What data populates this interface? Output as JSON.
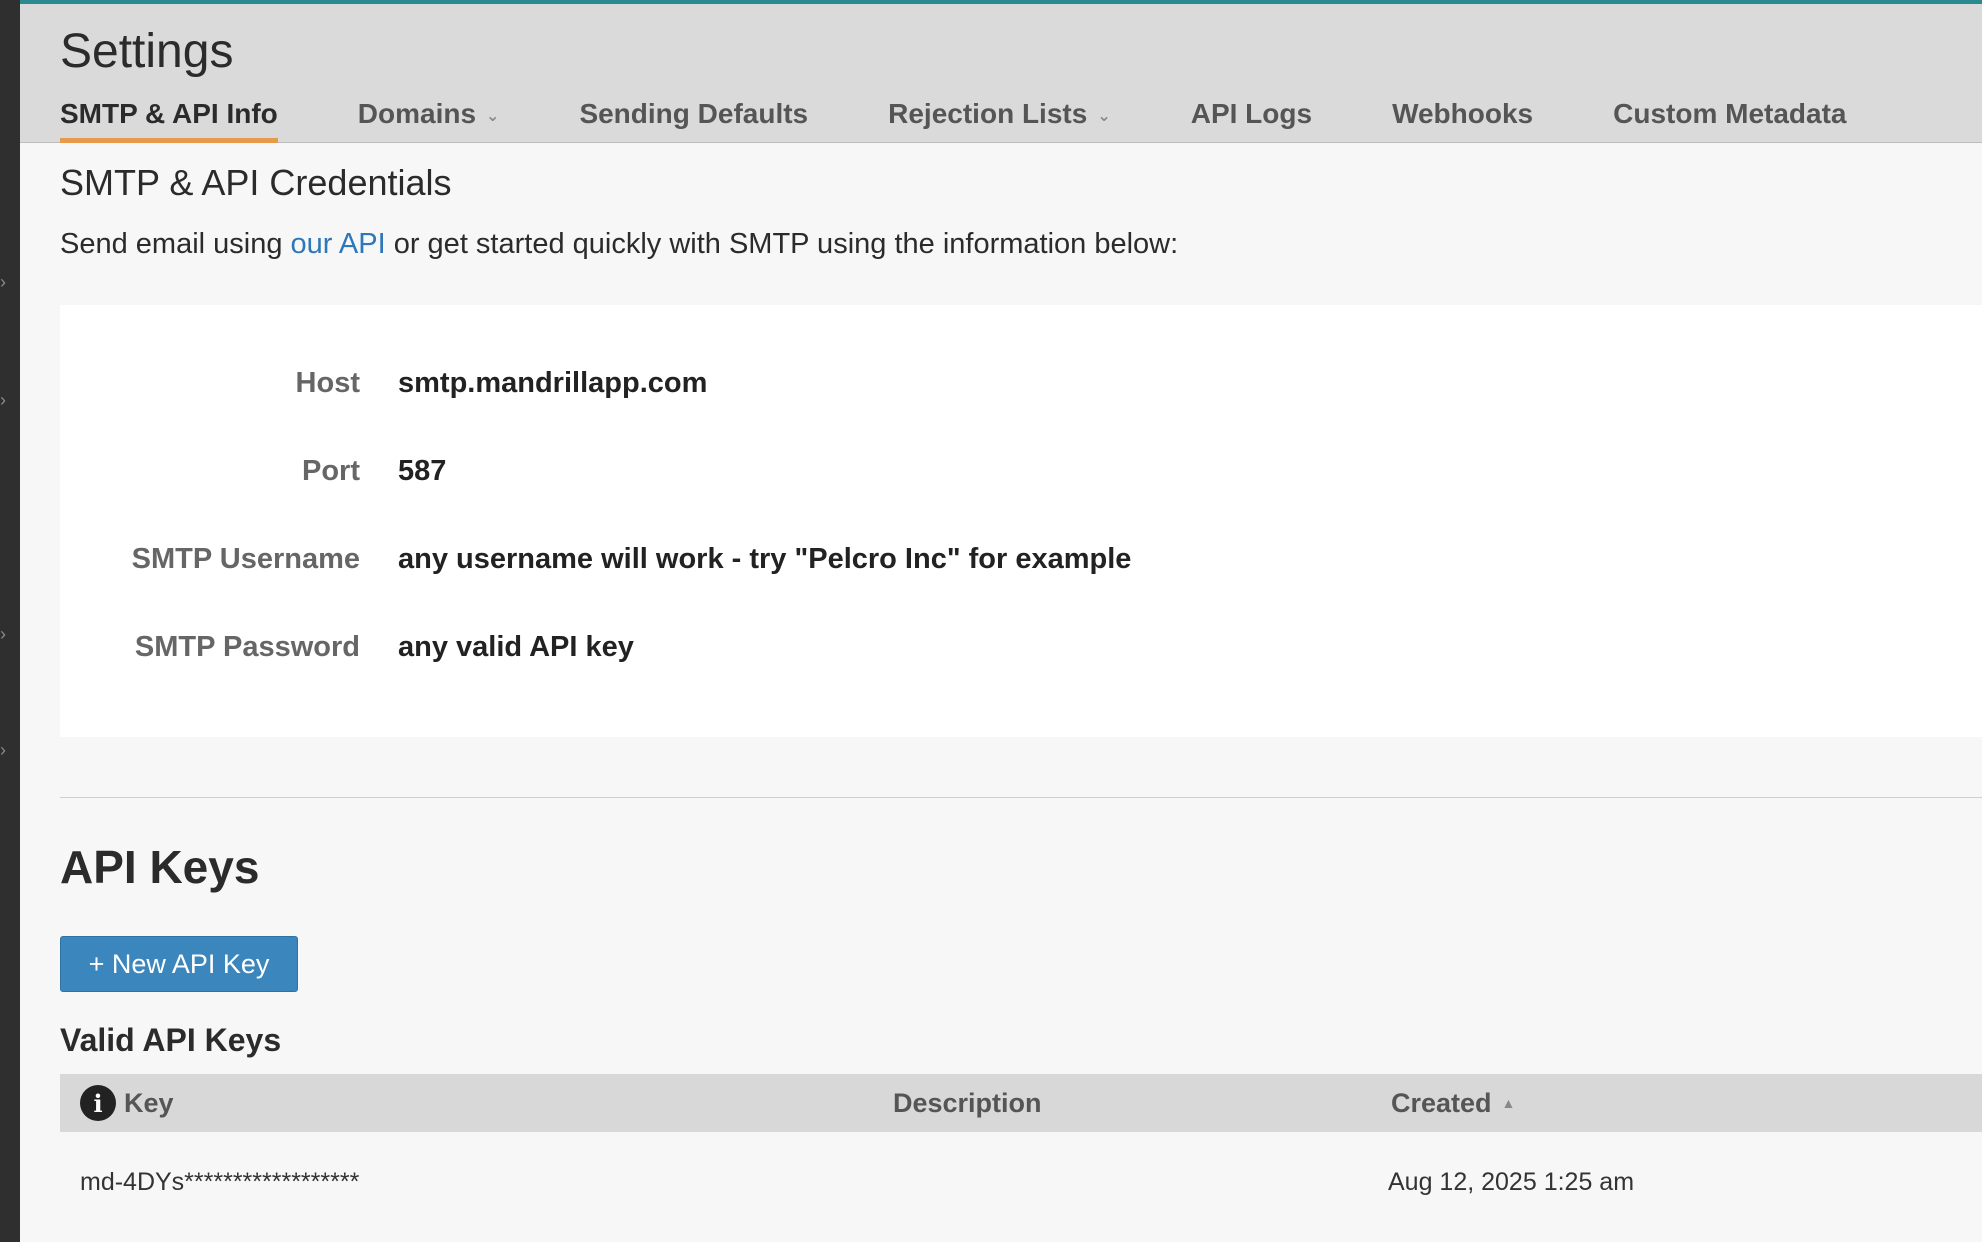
{
  "header": {
    "title": "Settings",
    "tabs": [
      {
        "label": "SMTP & API Info",
        "active": true,
        "has_dropdown": false
      },
      {
        "label": "Domains",
        "active": false,
        "has_dropdown": true
      },
      {
        "label": "Sending Defaults",
        "active": false,
        "has_dropdown": false
      },
      {
        "label": "Rejection Lists",
        "active": false,
        "has_dropdown": true
      },
      {
        "label": "API Logs",
        "active": false,
        "has_dropdown": false
      },
      {
        "label": "Webhooks",
        "active": false,
        "has_dropdown": false
      },
      {
        "label": "Custom Metadata",
        "active": false,
        "has_dropdown": false
      }
    ]
  },
  "credentials": {
    "title": "SMTP & API Credentials",
    "intro_before": "Send email using ",
    "intro_link": "our API",
    "intro_after": " or get started quickly with SMTP using the information below:",
    "rows": [
      {
        "label": "Host",
        "value": "smtp.mandrillapp.com"
      },
      {
        "label": "Port",
        "value": "587"
      },
      {
        "label": "SMTP Username",
        "value": "any username will work - try \"Pelcro Inc\" for example"
      },
      {
        "label": "SMTP Password",
        "value": "any valid API key"
      }
    ]
  },
  "api_keys": {
    "title": "API Keys",
    "new_button_label": "+ New API Key",
    "valid_title": "Valid API Keys",
    "columns": {
      "key": "Key",
      "description": "Description",
      "created": "Created"
    },
    "rows": [
      {
        "key": "md-4DYs******************",
        "description": "",
        "created": "Aug 12, 2025 1:25 am"
      }
    ]
  },
  "colors": {
    "accent_tab": "#e69a4a",
    "link": "#2e77b8",
    "button": "#3a86bd",
    "top_bar": "#2a8a8e"
  },
  "icons": {
    "info": "i",
    "chevron_down": "⌄",
    "sort_asc": "▲",
    "rail_chevron": "›"
  }
}
